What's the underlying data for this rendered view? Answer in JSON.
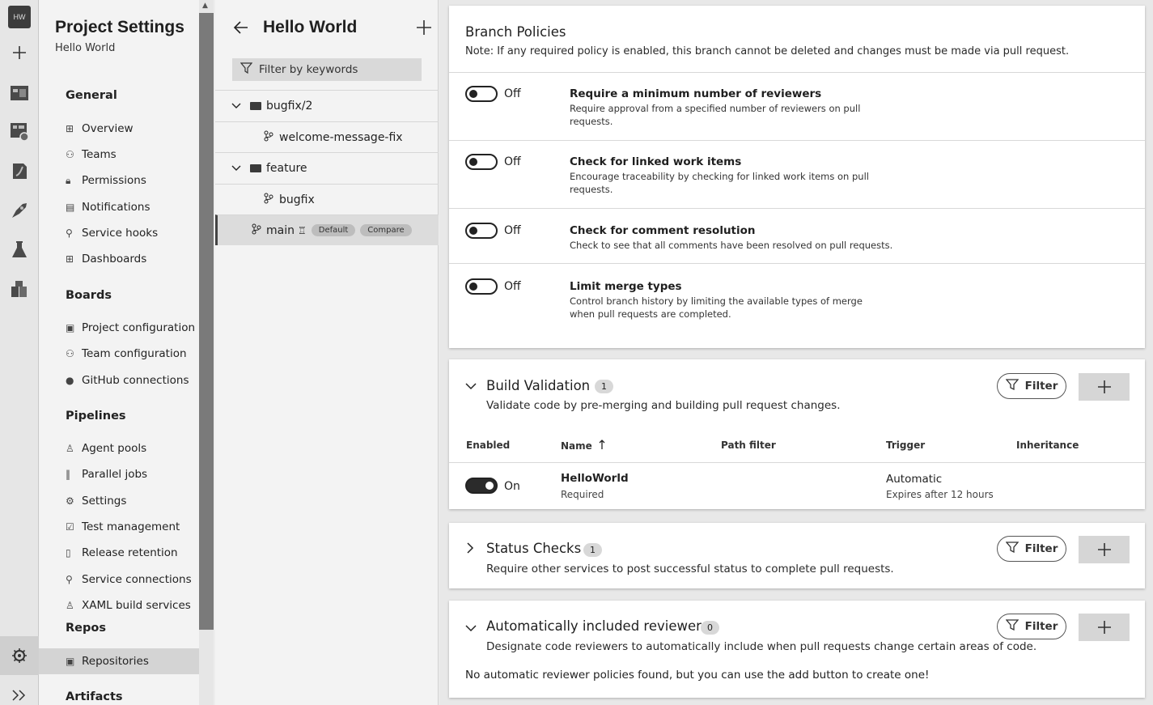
{
  "rail": {
    "avatar": "HW",
    "icons": [
      "plus-icon",
      "overview-icon",
      "boards-icon",
      "repos-icon",
      "pipelines-icon",
      "test-plans-icon",
      "artifacts-icon"
    ],
    "settings_icon": "gear-icon",
    "expand_icon": "double-chevron-icon"
  },
  "nav": {
    "title": "Project Settings",
    "subtitle": "Hello World",
    "sections": {
      "general": "General",
      "boards": "Boards",
      "pipelines": "Pipelines",
      "repos": "Repos",
      "artifacts": "Artifacts"
    },
    "general_items": [
      "Overview",
      "Teams",
      "Permissions",
      "Notifications",
      "Service hooks",
      "Dashboards"
    ],
    "boards_items": [
      "Project configuration",
      "Team configuration",
      "GitHub connections"
    ],
    "pipelines_items": [
      "Agent pools",
      "Parallel jobs",
      "Settings",
      "Test management",
      "Release retention",
      "Service connections",
      "XAML build services"
    ],
    "repos_items": [
      "Repositories"
    ]
  },
  "tree": {
    "title": "Hello World",
    "filter_placeholder": "Filter by keywords",
    "rows": [
      {
        "label": "bugfix/2"
      },
      {
        "label": "welcome-message-fix"
      },
      {
        "label": "feature"
      },
      {
        "label": "bugfix"
      },
      {
        "label": "main",
        "badge_default": "Default",
        "badge_compare": "Compare"
      }
    ]
  },
  "branch_policies": {
    "title": "Branch Policies",
    "note": "Note: If any required policy is enabled, this branch cannot be deleted and changes must be made via pull request.",
    "policies": [
      {
        "state": "Off",
        "title": "Require a minimum number of reviewers",
        "desc": "Require approval from a specified number of reviewers on pull requests."
      },
      {
        "state": "Off",
        "title": "Check for linked work items",
        "desc": "Encourage traceability by checking for linked work items on pull requests."
      },
      {
        "state": "Off",
        "title": "Check for comment resolution",
        "desc": "Check to see that all comments have been resolved on pull requests."
      },
      {
        "state": "Off",
        "title": "Limit merge types",
        "desc": "Control branch history by limiting the available types of merge when pull requests are completed."
      }
    ]
  },
  "build_validation": {
    "title": "Build Validation",
    "count": "1",
    "desc": "Validate code by pre-merging and building pull request changes.",
    "filter_label": "Filter",
    "columns": {
      "enabled": "Enabled",
      "name": "Name",
      "sort_icon": "arrow-up-icon",
      "path_filter": "Path filter",
      "trigger": "Trigger",
      "inheritance": "Inheritance"
    },
    "row": {
      "state": "On",
      "name": "HelloWorld",
      "required": "Required",
      "trigger": "Automatic",
      "expires": "Expires after 12 hours"
    }
  },
  "status_checks": {
    "title": "Status Checks",
    "count": "1",
    "desc": "Require other services to post successful status to complete pull requests.",
    "filter_label": "Filter"
  },
  "auto_reviewers": {
    "title": "Automatically included reviewers",
    "count": "0",
    "desc": "Designate code reviewers to automatically include when pull requests change certain areas of code.",
    "filter_label": "Filter",
    "empty": "No automatic reviewer policies found, but you can use the add button to create one!"
  }
}
